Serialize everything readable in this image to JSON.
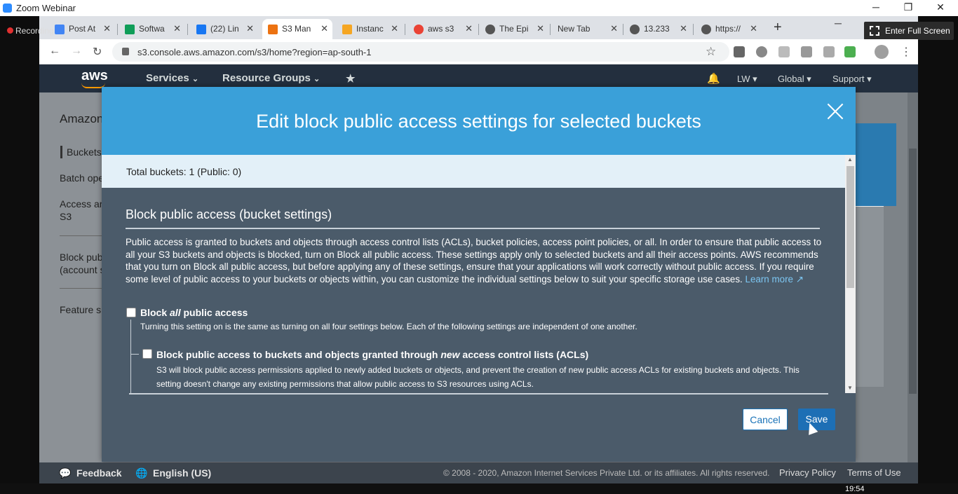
{
  "zoom": {
    "title": "Zoom Webinar",
    "recording_label": "Recording",
    "fullscreen_label": "Enter Full Screen"
  },
  "browser": {
    "tabs": [
      {
        "label": "Post At",
        "icon": "meet-icon",
        "color": "#4285f4"
      },
      {
        "label": "Softwa",
        "icon": "drive-icon",
        "color": "#0f9d58"
      },
      {
        "label": "(22) Lin",
        "icon": "facebook-icon",
        "color": "#1877f2"
      },
      {
        "label": "S3 Man",
        "icon": "aws-s3-icon",
        "color": "#ec7211",
        "active": true
      },
      {
        "label": "Instanc",
        "icon": "aws-ec2-icon",
        "color": "#f5a623"
      },
      {
        "label": "aws s3",
        "icon": "google-icon",
        "color": "#ea4335"
      },
      {
        "label": "The Epi",
        "icon": "globe-icon",
        "color": "#555555"
      },
      {
        "label": "New Tab",
        "icon": "",
        "color": ""
      },
      {
        "label": "13.233",
        "icon": "globe-icon",
        "color": "#555555"
      },
      {
        "label": "https://",
        "icon": "globe-icon",
        "color": "#555555"
      }
    ],
    "new_tab": "+",
    "url": "s3.console.aws.amazon.com/s3/home?region=ap-south-1"
  },
  "aws_header": {
    "logo": "aws",
    "services": "Services",
    "resource_groups": "Resource Groups",
    "user": "LW",
    "region": "Global",
    "support": "Support"
  },
  "sidebar": {
    "title": "Amazon",
    "items": [
      "Buckets",
      "Batch ope",
      "Access ar",
      "S3",
      "Block pub",
      "(account s",
      "Feature sp"
    ]
  },
  "modal": {
    "title": "Edit block public access settings for selected buckets",
    "summary": "Total buckets: 1 (Public: 0)",
    "section_title": "Block public access (bucket settings)",
    "description": "Public access is granted to buckets and objects through access control lists (ACLs), bucket policies, access point policies, or all. In order to ensure that public access to all your S3 buckets and objects is blocked, turn on Block all public access. These settings apply only to selected buckets and all their access points. AWS recommends that you turn on Block all public access, but before applying any of these settings, ensure that your applications will work correctly without public access. If you require some level of public access to your buckets or objects within, you can customize the individual settings below to suit your specific storage use cases.",
    "learn_more": "Learn more",
    "block_all": {
      "label_pre": "Block ",
      "label_em": "all",
      "label_post": " public access",
      "desc": "Turning this setting on is the same as turning on all four settings below. Each of the following settings are independent of one another.",
      "checked": false
    },
    "block_acl": {
      "label_pre": "Block public access to buckets and objects granted through ",
      "label_em": "new",
      "label_post": " access control lists (ACLs)",
      "desc": "S3 will block public access permissions applied to newly added buckets or objects, and prevent the creation of new public access ACLs for existing buckets and objects. This setting doesn't change any existing permissions that allow public access to S3 resources using ACLs.",
      "checked": false
    },
    "cancel": "Cancel",
    "save": "Save"
  },
  "footer": {
    "feedback": "Feedback",
    "language": "English (US)",
    "copyright": "© 2008 - 2020, Amazon Internet Services Private Ltd. or its affiliates. All rights reserved.",
    "privacy": "Privacy Policy",
    "terms": "Terms of Use"
  },
  "taskbar": {
    "time": "19:54"
  },
  "colors": {
    "modal_header": "#3aa0d9",
    "modal_body": "#4b5b6a",
    "aws_nav": "#232f3e",
    "save_button": "#1d6fb5"
  }
}
